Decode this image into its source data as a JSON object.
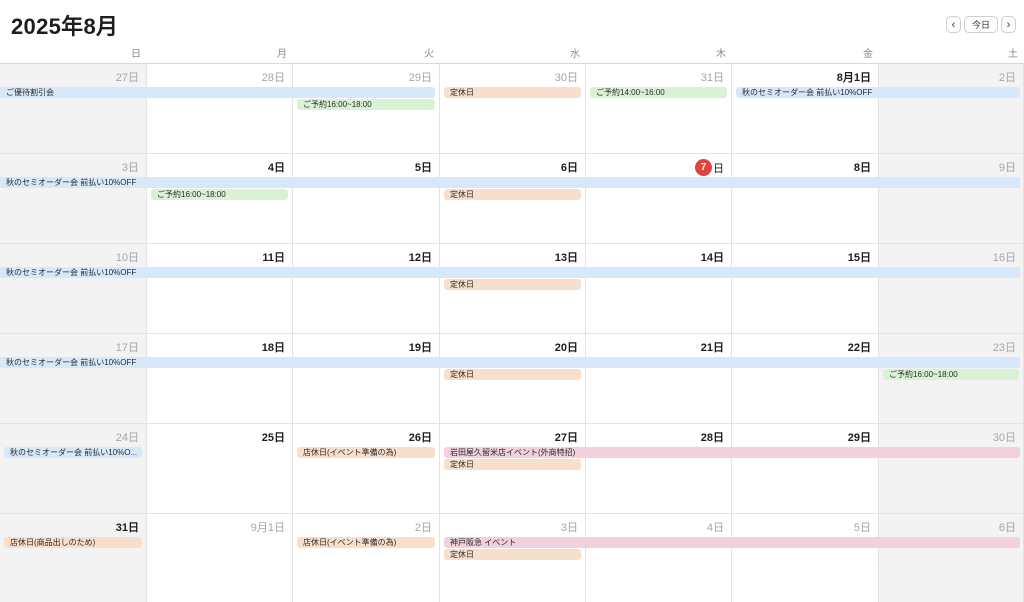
{
  "header": {
    "title": "2025年8月",
    "prev_label": "‹",
    "today_label": "今日",
    "next_label": "›"
  },
  "weekdays": [
    "日",
    "月",
    "火",
    "水",
    "木",
    "金",
    "土"
  ],
  "colors": {
    "blue": "#d6e8fa",
    "green": "#d9f2d3",
    "orange": "#f8dfcc",
    "pink": "#f2d0dc",
    "today": "#e0443e"
  },
  "weeks": [
    [
      {
        "label": "27日",
        "muted": true
      },
      {
        "label": "28日",
        "muted": true
      },
      {
        "label": "29日",
        "muted": true
      },
      {
        "label": "30日",
        "muted": true
      },
      {
        "label": "31日",
        "muted": true
      },
      {
        "label": "8月1日",
        "muted": false
      },
      {
        "label": "2日",
        "muted": true
      }
    ],
    [
      {
        "label": "3日",
        "muted": true
      },
      {
        "label": "4日",
        "muted": false
      },
      {
        "label": "5日",
        "muted": false
      },
      {
        "label": "6日",
        "muted": false
      },
      {
        "label": "7",
        "suffix": "日",
        "muted": false,
        "today": true
      },
      {
        "label": "8日",
        "muted": false
      },
      {
        "label": "9日",
        "muted": true
      }
    ],
    [
      {
        "label": "10日",
        "muted": true
      },
      {
        "label": "11日",
        "muted": false
      },
      {
        "label": "12日",
        "muted": false
      },
      {
        "label": "13日",
        "muted": false
      },
      {
        "label": "14日",
        "muted": false
      },
      {
        "label": "15日",
        "muted": false
      },
      {
        "label": "16日",
        "muted": true
      }
    ],
    [
      {
        "label": "17日",
        "muted": true
      },
      {
        "label": "18日",
        "muted": false
      },
      {
        "label": "19日",
        "muted": false
      },
      {
        "label": "20日",
        "muted": false
      },
      {
        "label": "21日",
        "muted": false
      },
      {
        "label": "22日",
        "muted": false
      },
      {
        "label": "23日",
        "muted": true
      }
    ],
    [
      {
        "label": "24日",
        "muted": true
      },
      {
        "label": "25日",
        "muted": false
      },
      {
        "label": "26日",
        "muted": false
      },
      {
        "label": "27日",
        "muted": false
      },
      {
        "label": "28日",
        "muted": false
      },
      {
        "label": "29日",
        "muted": false
      },
      {
        "label": "30日",
        "muted": true
      }
    ],
    [
      {
        "label": "31日",
        "muted": false
      },
      {
        "label": "9月1日",
        "muted": true
      },
      {
        "label": "2日",
        "muted": true
      },
      {
        "label": "3日",
        "muted": true
      },
      {
        "label": "4日",
        "muted": true
      },
      {
        "label": "5日",
        "muted": true
      },
      {
        "label": "6日",
        "muted": true
      }
    ]
  ],
  "events": [
    {
      "title": "ご優待割引会",
      "week": 0,
      "start": 0,
      "span": 3,
      "slot": 0,
      "color": "blue"
    },
    {
      "title": "ご予約16:00~18:00",
      "week": 0,
      "start": 2,
      "span": 1,
      "slot": 1,
      "color": "green"
    },
    {
      "title": "定休日",
      "week": 0,
      "start": 3,
      "span": 1,
      "slot": 0,
      "color": "orange"
    },
    {
      "title": "ご予約14:00~16:00",
      "week": 0,
      "start": 4,
      "span": 1,
      "slot": 0,
      "color": "green"
    },
    {
      "title": "秋のセミオーダー会 前払い10%OFF",
      "week": 0,
      "start": 5,
      "span": 2,
      "slot": 0,
      "color": "blue"
    },
    {
      "title": "秋のセミオーダー会 前払い10%OFF",
      "week": 1,
      "start": 0,
      "span": 7,
      "slot": 0,
      "color": "blue"
    },
    {
      "title": "ご予約16:00~18:00",
      "week": 1,
      "start": 1,
      "span": 1,
      "slot": 1,
      "color": "green"
    },
    {
      "title": "定休日",
      "week": 1,
      "start": 3,
      "span": 1,
      "slot": 1,
      "color": "orange"
    },
    {
      "title": "秋のセミオーダー会 前払い10%OFF",
      "week": 2,
      "start": 0,
      "span": 7,
      "slot": 0,
      "color": "blue"
    },
    {
      "title": "定休日",
      "week": 2,
      "start": 3,
      "span": 1,
      "slot": 1,
      "color": "orange"
    },
    {
      "title": "秋のセミオーダー会 前払い10%OFF",
      "week": 3,
      "start": 0,
      "span": 7,
      "slot": 0,
      "color": "blue"
    },
    {
      "title": "定休日",
      "week": 3,
      "start": 3,
      "span": 1,
      "slot": 1,
      "color": "orange"
    },
    {
      "title": "ご予約16:00~18:00",
      "week": 3,
      "start": 6,
      "span": 1,
      "slot": 1,
      "color": "green"
    },
    {
      "title": "秋のセミオーダー会 前払い10%O...",
      "week": 4,
      "start": 0,
      "span": 1,
      "slot": 0,
      "color": "blue"
    },
    {
      "title": "店休日(イベント準備の為)",
      "week": 4,
      "start": 2,
      "span": 1,
      "slot": 0,
      "color": "orange"
    },
    {
      "title": "岩田屋久留米店イベント(外商特招)",
      "week": 4,
      "start": 3,
      "span": 4,
      "slot": 0,
      "color": "pink"
    },
    {
      "title": "定休日",
      "week": 4,
      "start": 3,
      "span": 1,
      "slot": 1,
      "color": "orange"
    },
    {
      "title": "店休日(商品出しのため)",
      "week": 5,
      "start": 0,
      "span": 1,
      "slot": 0,
      "color": "orange"
    },
    {
      "title": "店休日(イベント準備の為)",
      "week": 5,
      "start": 2,
      "span": 1,
      "slot": 0,
      "color": "orange"
    },
    {
      "title": "神戸阪急 イベント",
      "week": 5,
      "start": 3,
      "span": 4,
      "slot": 0,
      "color": "pink"
    },
    {
      "title": "定休日",
      "week": 5,
      "start": 3,
      "span": 1,
      "slot": 1,
      "color": "orange"
    }
  ]
}
